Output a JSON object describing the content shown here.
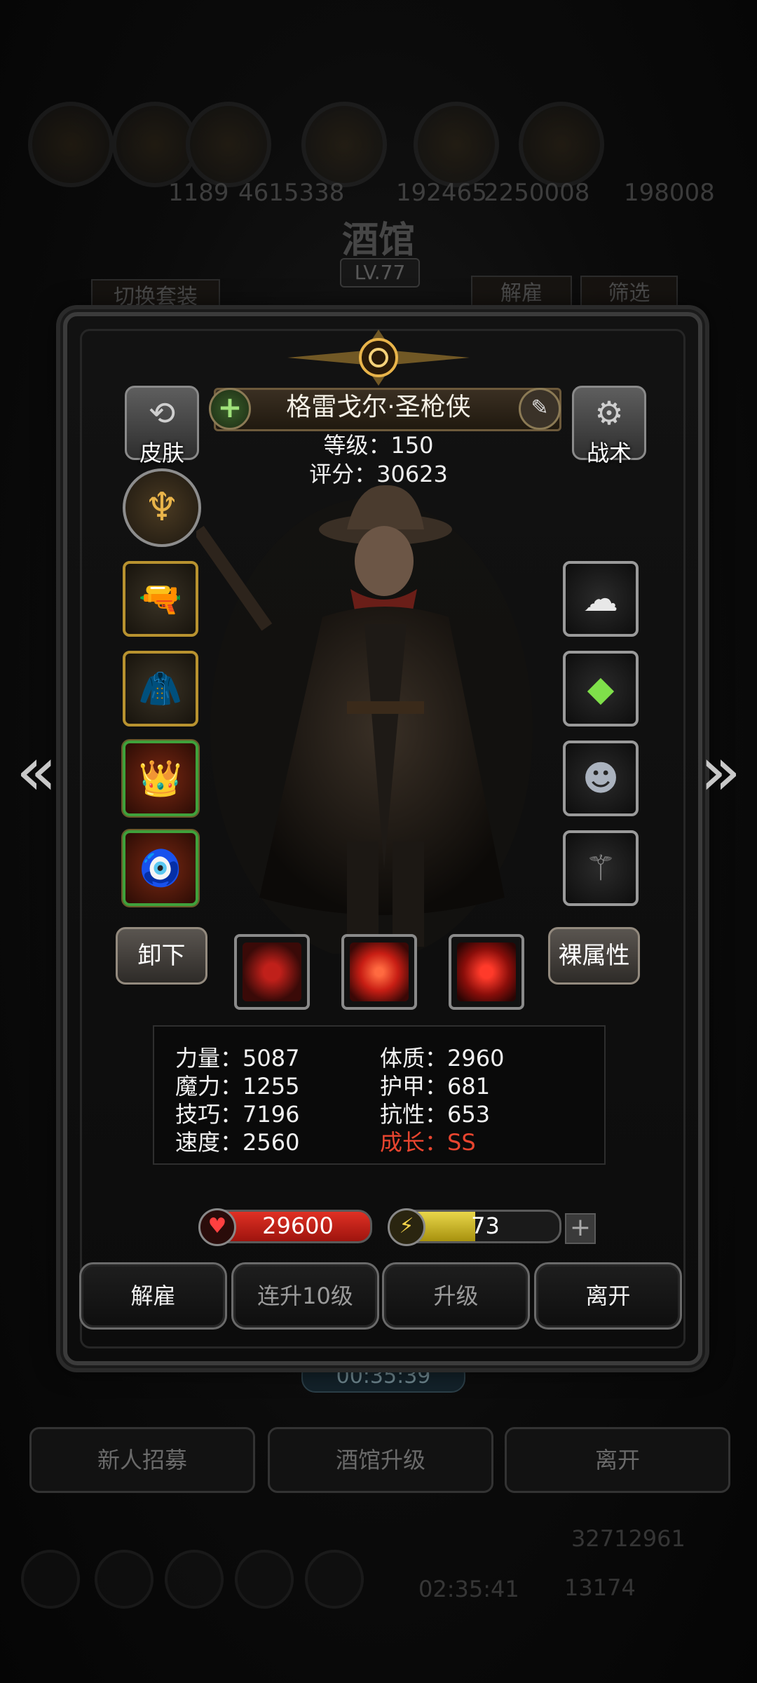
{
  "background": {
    "resources": [
      "1189",
      "4615338",
      "192465",
      "2250008",
      "198008"
    ],
    "title": "酒馆",
    "level": "LV.77",
    "switch_outfit": "切换套装",
    "dismiss": "解雇",
    "filter": "筛选",
    "timer": "00:35:39",
    "bottom_buttons": [
      "新人招募",
      "酒馆升级",
      "离开"
    ],
    "footer": {
      "gold": "32712961",
      "gems": "13174",
      "timer": "02:35:41"
    }
  },
  "hero": {
    "name": "格雷戈尔·圣枪侠",
    "level_label": "等级：150",
    "score_label": "评分：30623",
    "skin_label": "皮肤",
    "tactics_label": "战术"
  },
  "equipment_left": [
    "revolver-icon",
    "leather-coat-icon",
    "spiked-crown-icon",
    "amulet-icon"
  ],
  "equipment_right": [
    "cloud-ring-icon",
    "green-crystal-icon",
    "mask-icon",
    "staff-icon"
  ],
  "buttons": {
    "unequip": "卸下",
    "base_attr": "裸属性"
  },
  "stats": [
    {
      "label": "力量：5087"
    },
    {
      "label": "体质：2960"
    },
    {
      "label": "魔力：1255"
    },
    {
      "label": "护甲：681"
    },
    {
      "label": "技巧：7196"
    },
    {
      "label": "抗性：653"
    },
    {
      "label": "速度：2560"
    },
    {
      "label": "成长：SS"
    }
  ],
  "hp": "29600",
  "energy": {
    "value": "73",
    "fill_fraction": 0.5
  },
  "actions": [
    "解雇",
    "连升10级",
    "升级",
    "离开"
  ],
  "colors": {
    "growth": "#e8452f",
    "hp": "#e03024",
    "energy": "#e9d64a",
    "frame_gold": "#b8922f",
    "frame_green": "#3fa13b"
  }
}
